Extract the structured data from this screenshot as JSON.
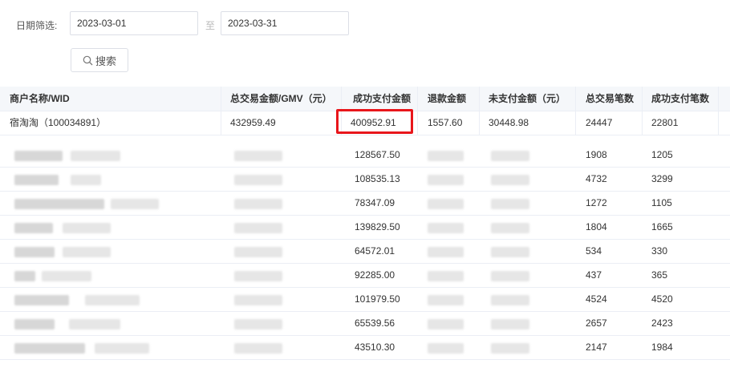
{
  "filter": {
    "label": "日期筛选:",
    "start_date": "2023-03-01",
    "separator": "至",
    "end_date": "2023-03-31",
    "search_label": "搜索",
    "search_icon": "search-icon"
  },
  "table": {
    "headers": [
      "商户名称/WID",
      "总交易金额/GMV（元）",
      "成功支付金额",
      "退款金额",
      "未支付金额（元）",
      "总交易笔数",
      "成功支付笔数"
    ],
    "first_row": {
      "merchant": "宿淘淘（100034891）",
      "gmv": "432959.49",
      "paid_amount": "400952.91",
      "refund": "1557.60",
      "unpaid": "30448.98",
      "total_count": "24447",
      "paid_count": "22801"
    },
    "rows": [
      {
        "paid_amount": "128567.50",
        "total_count": "1908",
        "paid_count": "1205"
      },
      {
        "paid_amount": "108535.13",
        "total_count": "4732",
        "paid_count": "3299"
      },
      {
        "paid_amount": "78347.09",
        "total_count": "1272",
        "paid_count": "1105"
      },
      {
        "paid_amount": "139829.50",
        "total_count": "1804",
        "paid_count": "1665"
      },
      {
        "paid_amount": "64572.01",
        "total_count": "534",
        "paid_count": "330"
      },
      {
        "paid_amount": "92285.00",
        "total_count": "437",
        "paid_count": "365"
      },
      {
        "paid_amount": "101979.50",
        "total_count": "4524",
        "paid_count": "4520"
      },
      {
        "paid_amount": "65539.56",
        "total_count": "2657",
        "paid_count": "2423"
      },
      {
        "paid_amount": "43510.30",
        "total_count": "2147",
        "paid_count": "1984"
      }
    ]
  },
  "colors": {
    "highlight": "#e8161b",
    "header_bg": "#f5f7fa",
    "border": "#ebeef5"
  }
}
